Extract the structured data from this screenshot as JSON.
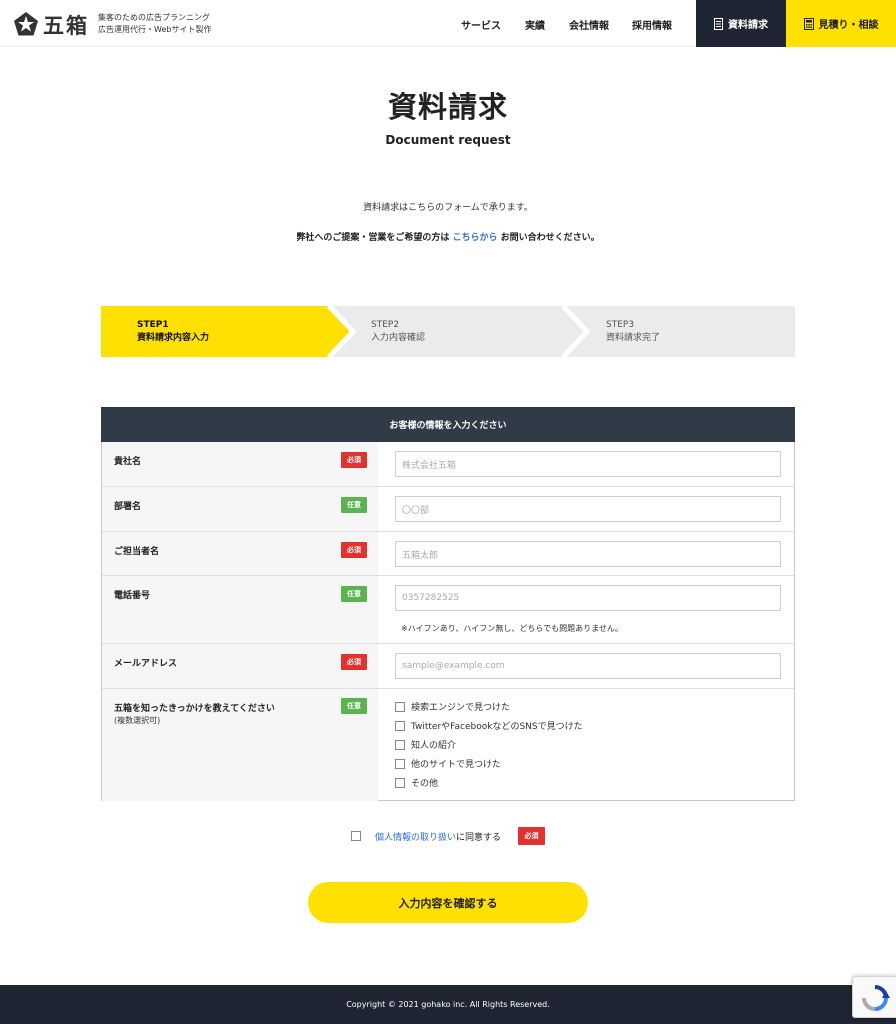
{
  "header": {
    "logo_text": "五箱",
    "tagline_line1": "集客のための広告プランニング",
    "tagline_line2": "広告運用代行・Webサイト製作",
    "nav": [
      "サービス",
      "実績",
      "会社情報",
      "採用情報"
    ],
    "doc_button": "資料請求",
    "estimate_button": "見積り・相談"
  },
  "page": {
    "title_jp": "資料請求",
    "title_en": "Document request",
    "intro1": "資料請求はこちらのフォームで承ります。",
    "intro2_before": "弊社へのご提案・営業をご希望の方は",
    "intro2_link": "こちらから",
    "intro2_after": "お問い合わせください。"
  },
  "steps": [
    {
      "num": "STEP1",
      "label": "資料請求内容入力",
      "active": true
    },
    {
      "num": "STEP2",
      "label": "入力内容確認",
      "active": false
    },
    {
      "num": "STEP3",
      "label": "資料請求完了",
      "active": false
    }
  ],
  "form": {
    "heading": "お客様の情報を入力ください",
    "fields": [
      {
        "label": "貴社名",
        "badge": "必須",
        "placeholder": "株式会社五箱"
      },
      {
        "label": "部署名",
        "badge": "任意",
        "placeholder": "〇〇部"
      },
      {
        "label": "ご担当者名",
        "badge": "必須",
        "placeholder": "五箱太郎"
      },
      {
        "label": "電話番号",
        "badge": "任意",
        "placeholder": "0357282525",
        "note": "※ハイフンあり、ハイフン無し、どちらでも問題ありません。"
      },
      {
        "label": "メールアドレス",
        "badge": "必須",
        "placeholder": "sample@example.com"
      }
    ],
    "source": {
      "label": "五箱を知ったきっかけを教えてください",
      "sublabel": "(複数選択可)",
      "badge": "任意",
      "options": [
        "検索エンジンで見つけた",
        "TwitterやFacebookなどのSNSで見つけた",
        "知人の紹介",
        "他のサイトで見つけた",
        "その他"
      ]
    }
  },
  "consent": {
    "link": "個人情報の取り扱い",
    "text": "に同意する",
    "badge": "必須"
  },
  "submit_label": "入力内容を確認する",
  "footer": {
    "copyright": "Copyright © 2021 gohako inc. All Rights Reserved."
  },
  "colors": {
    "accent_yellow": "#ffe000",
    "dark_navy": "#1f2532",
    "form_header": "#313a47",
    "required_red": "#e0332f",
    "optional_green": "#5ab450",
    "link_blue": "#2a6fd6"
  }
}
